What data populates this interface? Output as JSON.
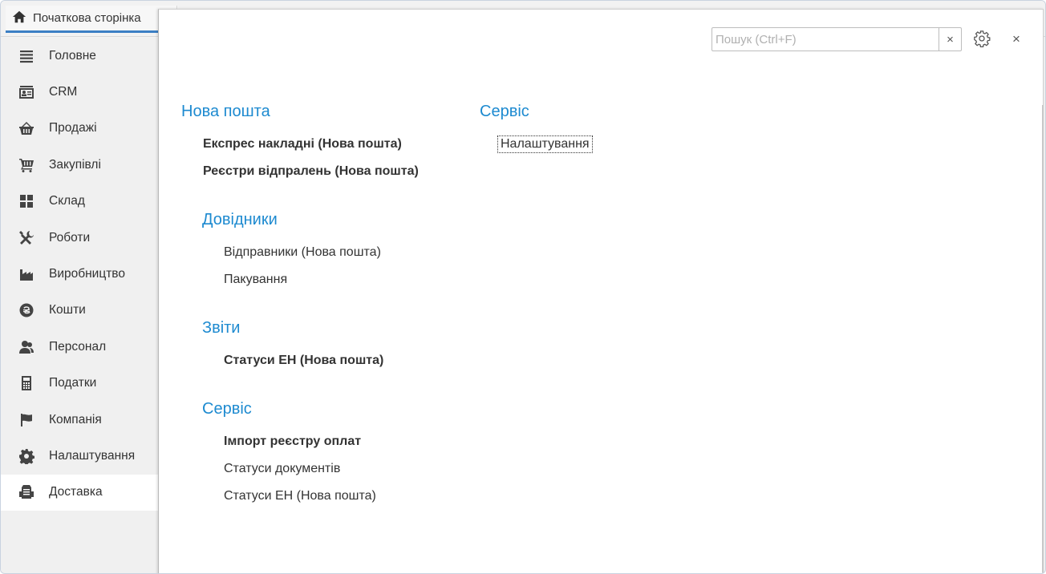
{
  "home_tab": {
    "label": "Початкова сторінка"
  },
  "sidebar": {
    "items": [
      {
        "label": "Головне",
        "icon": "menu-lines-icon"
      },
      {
        "label": "CRM",
        "icon": "contact-card-icon"
      },
      {
        "label": "Продажі",
        "icon": "basket-icon"
      },
      {
        "label": "Закупівлі",
        "icon": "cart-icon"
      },
      {
        "label": "Склад",
        "icon": "grid-warehouse-icon"
      },
      {
        "label": "Роботи",
        "icon": "tools-icon"
      },
      {
        "label": "Виробництво",
        "icon": "factory-icon"
      },
      {
        "label": "Кошти",
        "icon": "hryvnia-coin-icon"
      },
      {
        "label": "Персонал",
        "icon": "people-icon"
      },
      {
        "label": "Податки",
        "icon": "calculator-icon"
      },
      {
        "label": "Компанія",
        "icon": "flag-icon"
      },
      {
        "label": "Налаштування",
        "icon": "gear-icon"
      },
      {
        "label": "Доставка",
        "icon": "delivery-box-icon",
        "active": true
      }
    ]
  },
  "search": {
    "placeholder": "Пошук (Ctrl+F)",
    "value": "",
    "clear_label": "×"
  },
  "panel": {
    "close_label": "×"
  },
  "sections": {
    "nova_poshta": {
      "title": "Нова пошта",
      "items": [
        "Експрес накладні (Нова пошта)",
        "Реєстри відпралень (Нова пошта)"
      ]
    },
    "dovidnyky": {
      "title": "Довідники",
      "items": [
        "Відправники (Нова пошта)",
        "Пакування"
      ]
    },
    "zvity": {
      "title": "Звіти",
      "items": [
        "Статуси ЕН (Нова пошта)"
      ]
    },
    "servis_left": {
      "title": "Сервіс",
      "items": [
        "Імпорт реєстру оплат",
        "Статуси документів",
        "Статуси ЕН (Нова пошта)"
      ]
    },
    "servis_right": {
      "title": "Сервіс",
      "items": [
        "Налаштування"
      ]
    }
  },
  "colors": {
    "accent": "#1d8ad0",
    "tab_underline": "#3b7fc4"
  }
}
